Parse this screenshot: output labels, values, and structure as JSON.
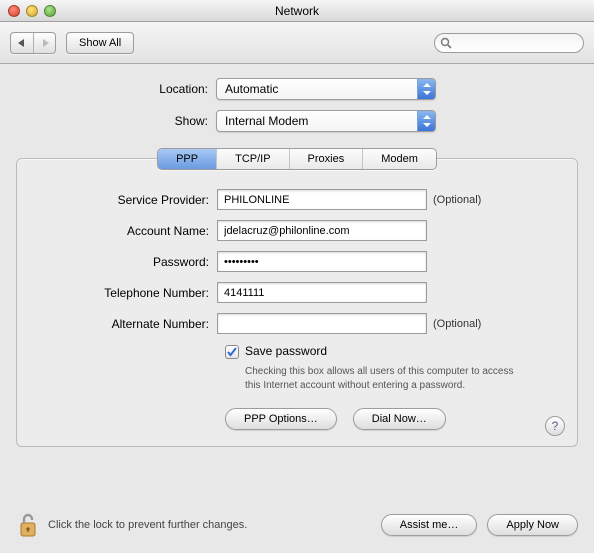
{
  "window": {
    "title": "Network"
  },
  "toolbar": {
    "show_all": "Show All",
    "search_placeholder": ""
  },
  "selectors": {
    "location_label": "Location:",
    "location_value": "Automatic",
    "show_label": "Show:",
    "show_value": "Internal Modem"
  },
  "tabs": {
    "ppp": "PPP",
    "tcpip": "TCP/IP",
    "proxies": "Proxies",
    "modem": "Modem"
  },
  "form": {
    "service_provider_label": "Service Provider:",
    "service_provider_value": "PHILONLINE",
    "account_name_label": "Account Name:",
    "account_name_value": "jdelacruz@philonline.com",
    "password_label": "Password:",
    "password_value": "•••••••••",
    "telephone_label": "Telephone Number:",
    "telephone_value": "4141111",
    "alternate_label": "Alternate Number:",
    "alternate_value": "",
    "optional": "(Optional)",
    "save_password_label": "Save password",
    "save_password_help": "Checking this box allows all users of this computer to access this Internet account without entering a password.",
    "ppp_options_btn": "PPP Options…",
    "dial_now_btn": "Dial Now…"
  },
  "footer": {
    "lock_text": "Click the lock to prevent further changes.",
    "assist_btn": "Assist me…",
    "apply_btn": "Apply Now"
  }
}
